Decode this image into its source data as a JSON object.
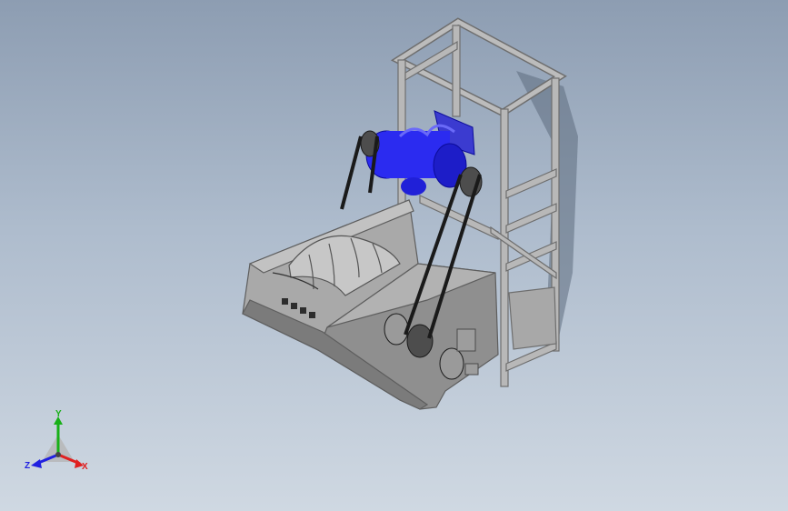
{
  "viewport": {
    "background_top": "#8d9db2",
    "background_bottom": "#cfd8e2"
  },
  "model": {
    "colors": {
      "frame": "#b8b8b8",
      "frame_dark": "#6e6e6e",
      "hopper": "#a9a9a9",
      "hopper_dark": "#7b7b7b",
      "motor": "#2b2bf0",
      "motor_dark": "#0c0c9a",
      "belt": "#1a1a1a",
      "shadow": "#5d6b7d"
    }
  },
  "triad": {
    "x_label": "X",
    "y_label": "Y",
    "z_label": "Z",
    "x_color": "#e02020",
    "y_color": "#18b018",
    "z_color": "#2020e0"
  }
}
